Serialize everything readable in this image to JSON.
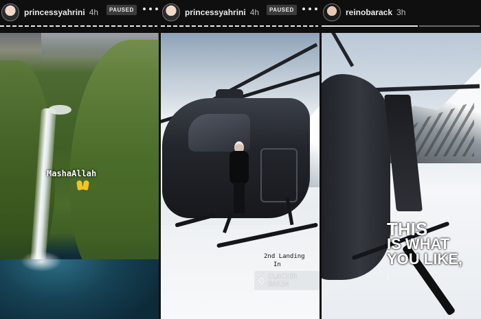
{
  "stories": [
    {
      "username": "princessyahrini",
      "time": "4h",
      "status": "PAUSED",
      "stickers": [
        "MashaAllah"
      ],
      "sticker_emoji": "raised-hands-icon"
    },
    {
      "username": "princessyahrini",
      "time": "4h",
      "status": "PAUSED",
      "caption_line1": "2nd Landing",
      "caption_line2": "In",
      "location": "CLACIER BASIN"
    },
    {
      "username": "reinobarack",
      "time": "3h",
      "big_text": [
        "THIS",
        "IS WHAT",
        "YOU LIKE,"
      ],
      "faded_text": "I"
    }
  ],
  "colors": {
    "background": "#0f0f10",
    "badge_bg": "#3b3b3b"
  }
}
